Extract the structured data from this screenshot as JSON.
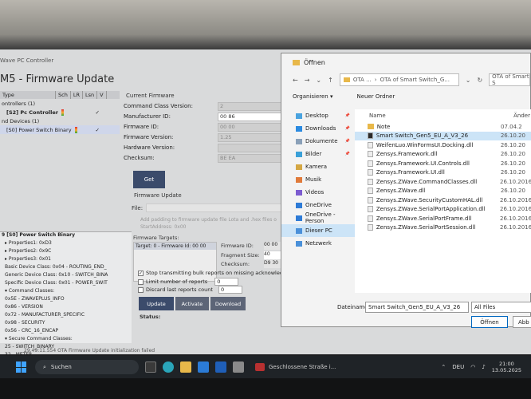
{
  "app": {
    "title_bar": "Wave PC Controller",
    "heading": "M5 - Firmware Update"
  },
  "tree": {
    "columns": [
      "Type",
      "Sch",
      "LR",
      "Lsn",
      "V"
    ],
    "rows": [
      {
        "label": "ontrollers (1)",
        "bold": false
      },
      {
        "label": "[S2] Pc Controller",
        "bold": true,
        "check": "✓"
      },
      {
        "label": "nd Devices (1)",
        "bold": false
      },
      {
        "label": "[S0] Power Switch Binary",
        "bold": false,
        "check": "✓"
      }
    ]
  },
  "properties": {
    "title": "9 [S0] Power Switch Binary",
    "rows": [
      "▸ Properties1: 0xD3",
      "▸ Properties2: 0x9C",
      "▸ Properties3: 0x01",
      "  Basic Device Class: 0x04 - ROUTING_END_",
      "  Generic Device Class: 0x10 - SWITCH_BINA",
      "  Specific Device Class: 0x01 - POWER_SWIT",
      "▾ Command Classes:",
      "    0x5E - ZWAVEPLUS_INFO",
      "    0x86 - VERSION",
      "    0x72 - MANUFACTURER_SPECIFIC",
      "    0x98 - SECURITY",
      "    0x56 - CRC_16_ENCAP",
      "▾ Secure Command Classes:",
      "    25 - SWITCH_BINARY",
      "    32 - METER"
    ]
  },
  "current_firmware": {
    "section": "Current Firmware",
    "fields": [
      {
        "label": "Command Class Version:",
        "value": "2",
        "active": false
      },
      {
        "label": "Manufacturer ID:",
        "value": "00 86",
        "active": true
      },
      {
        "label": "Firmware ID:",
        "value": "00 00",
        "active": false
      },
      {
        "label": "Firmware Version:",
        "value": "1.25",
        "active": false
      },
      {
        "label": "Hardware Version:",
        "value": "",
        "active": false
      },
      {
        "label": "Checksum:",
        "value": "BE EA",
        "active": false
      }
    ],
    "get_label": "Get"
  },
  "firmware_update": {
    "section": "Firmware Update",
    "file_label": "File:",
    "hint": "Add padding to firmware update file Lota and .hex files o",
    "start_address": "StartAddress: 0x00",
    "targets_label": "Firmware Targets:",
    "target_value": "Target: 0 - Firmware Id: 00 00",
    "firmware_id_label": "Firmware ID:",
    "firmware_id_value": "00 00",
    "fragment_size_label": "Fragment Size:",
    "fragment_size_value": "40",
    "checksum_label": "Checksum:",
    "checksum_value": "D9 30",
    "opt_stop": "Stop transmitting bulk reports on missing acknowledge",
    "opt_limit": "Limit number of reports",
    "opt_limit_value": "0",
    "opt_discard": "Discard last reports count",
    "opt_discard_value": "0",
    "update_label": "Update",
    "activate_label": "Activate",
    "download_label": "Download",
    "status_label": "Status:"
  },
  "status_bar": "29.49:11.554 OTA Firmware Update initialization failed",
  "dialog": {
    "title": "Öffnen",
    "path": [
      "OTA ...",
      "OTA of Smart Switch_G..."
    ],
    "search_placeholder": "OTA of Smart S",
    "organize": "Organisieren ▾",
    "new_folder": "Neuer Ordner",
    "nav": [
      {
        "label": "Desktop",
        "color": "#4aa3df",
        "pin": true
      },
      {
        "label": "Downloads",
        "color": "#2b8ae0",
        "pin": true
      },
      {
        "label": "Dokumente",
        "color": "#8aa0b8",
        "pin": true
      },
      {
        "label": "Bilder",
        "color": "#3aa0d8",
        "pin": true
      },
      {
        "label": "Kamera",
        "color": "#d4a744",
        "pin": false
      },
      {
        "label": "Musik",
        "color": "#e07a3a",
        "pin": false
      },
      {
        "label": "Videos",
        "color": "#7c5bd0",
        "pin": false
      },
      {
        "label": "OneDrive",
        "color": "#2e7bd6",
        "pin": false
      },
      {
        "label": "OneDrive - Person",
        "color": "#2e7bd6",
        "pin": false
      },
      {
        "label": "Dieser PC",
        "color": "#4a90d9",
        "pin": false,
        "selected": true
      },
      {
        "label": "Netzwerk",
        "color": "#4a90d9",
        "pin": false
      }
    ],
    "name_header": "Name",
    "date_header": "Änder",
    "files": [
      {
        "name": "Note",
        "date": "07.04.2",
        "selected": false
      },
      {
        "name": "Smart Switch_Gen5_EU_A_V3_26",
        "date": "26.10.20",
        "selected": true
      },
      {
        "name": "WeifenLuo.WinFormsUI.Docking.dll",
        "date": "26.10.20",
        "selected": false
      },
      {
        "name": "Zensys.Framework.dll",
        "date": "26.10.20",
        "selected": false
      },
      {
        "name": "Zensys.Framework.UI.Controls.dll",
        "date": "26.10.20",
        "selected": false
      },
      {
        "name": "Zensys.Framework.UI.dll",
        "date": "26.10.20",
        "selected": false
      },
      {
        "name": "Zensys.ZWave.CommandClasses.dll",
        "date": "26.10.2016",
        "selected": false
      },
      {
        "name": "Zensys.ZWave.dll",
        "date": "26.10.20",
        "selected": false
      },
      {
        "name": "Zensys.ZWave.SecurityCustomHAL.dll",
        "date": "26.10.2016",
        "selected": false
      },
      {
        "name": "Zensys.ZWave.SerialPortApplication.dll",
        "date": "26.10.2016",
        "selected": false
      },
      {
        "name": "Zensys.ZWave.SerialPortFrame.dll",
        "date": "26.10.2016",
        "selected": false
      },
      {
        "name": "Zensys.ZWave.SerialPortSession.dll",
        "date": "26.10.2016",
        "selected": false
      }
    ],
    "filename_label": "Dateiname:",
    "filename_value": "Smart Switch_Gen5_EU_A_V3_26",
    "filetype_value": "All Files",
    "open_label": "Öffnen",
    "cancel_label": "Abb"
  },
  "taskbar": {
    "search_label": "Suchen",
    "notification": "Geschlossene Straße i...",
    "language": "DEU",
    "time": "21:00",
    "date": "13.05.2025"
  }
}
